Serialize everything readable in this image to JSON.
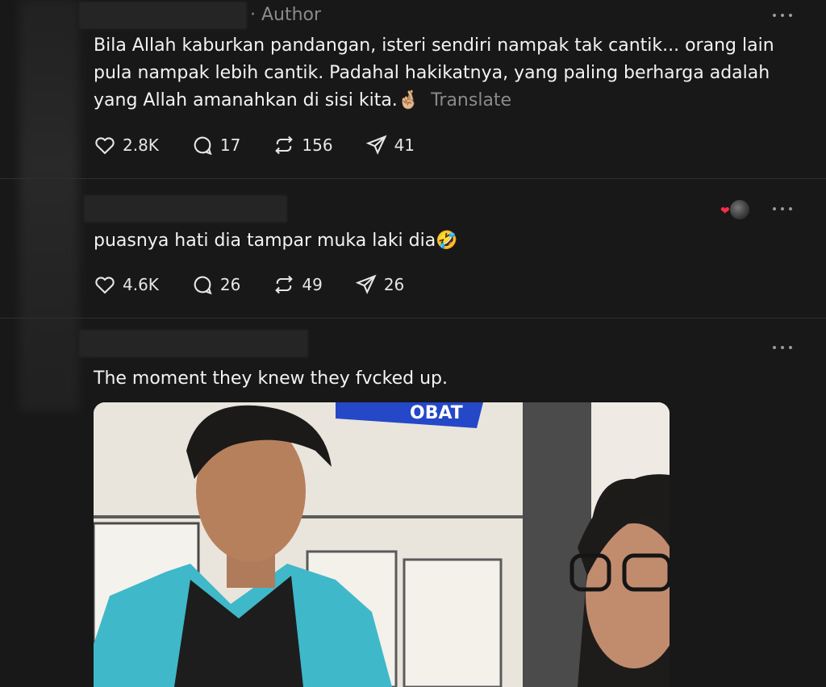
{
  "posts": [
    {
      "author_label": "· Author",
      "text": "Bila Allah kaburkan pandangan, isteri sendiri nampak tak cantik... orang lain pula nampak lebih cantik. Padahal hakikatnya, yang paling berharga adalah yang Allah amanahkan di sisi kita.",
      "emoji": "🤞🏼",
      "translate_label": "Translate",
      "likes": "2.8K",
      "replies": "17",
      "reposts": "156",
      "shares": "41"
    },
    {
      "text": "puasnya hati dia tampar muka laki dia",
      "emoji": "🤣",
      "likes": "4.6K",
      "replies": "26",
      "reposts": "49",
      "shares": "26"
    },
    {
      "text": "The moment they knew they fvcked up.",
      "media_sign": "OBAT"
    }
  ],
  "colors": {
    "background": "#181818",
    "text": "#f3f3f3",
    "muted": "#8a8a8a",
    "heart": "#ff2b4a",
    "jacket": "#3fb8c9"
  },
  "icons": [
    "heart-icon",
    "reply-icon",
    "repost-icon",
    "share-icon",
    "more-icon"
  ]
}
